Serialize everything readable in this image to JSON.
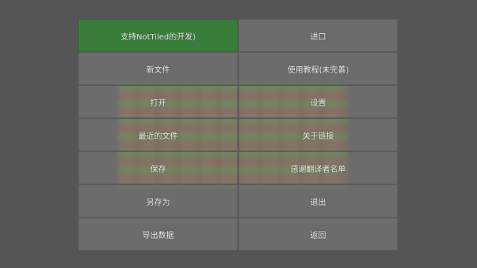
{
  "menu": {
    "left": [
      {
        "label": "支持NotTiled的开发)",
        "active": true
      },
      {
        "label": "新文件",
        "active": false
      },
      {
        "label": "打开",
        "active": false
      },
      {
        "label": "最近的文件",
        "active": false
      },
      {
        "label": "保存",
        "active": false
      },
      {
        "label": "另存为",
        "active": false
      },
      {
        "label": "导出数据",
        "active": false
      }
    ],
    "right": [
      {
        "label": "进口",
        "active": false
      },
      {
        "label": "使用教程(未完善)",
        "active": false
      },
      {
        "label": "设置",
        "active": false
      },
      {
        "label": "关于链接",
        "active": false
      },
      {
        "label": "感谢翻译者名单",
        "active": false
      },
      {
        "label": "退出",
        "active": false
      },
      {
        "label": "返回",
        "active": false
      }
    ]
  },
  "colors": {
    "background": "#555555",
    "button": "#808080",
    "active_button": "#3a7d3a",
    "text": "#f2f2f2"
  }
}
